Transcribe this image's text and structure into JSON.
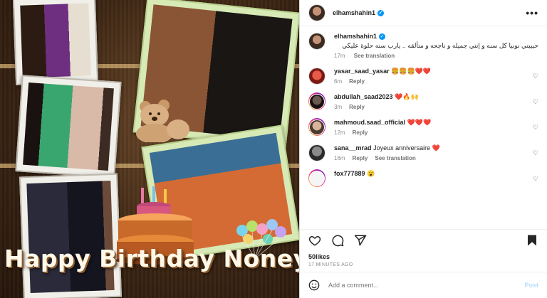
{
  "post_image": {
    "banner_text": "Happy Birthday Noneya"
  },
  "header": {
    "username": "elhamshahin1",
    "more_label": "•••"
  },
  "caption": {
    "username": "elhamshahin1",
    "text": "حبيبتي نونيا كل سنه و إنتي جميله و ناجحه و متألقه .. يارب سنه حلوة عليكي",
    "time": "17m",
    "see_translation": "See translation"
  },
  "comments": [
    {
      "username": "yasar_saad_yasar",
      "text": "🍔🍔🍔❤️❤️",
      "time": "6m",
      "reply": "Reply",
      "see_translation": ""
    },
    {
      "username": "abdullah_saad2023",
      "text": "❤️🔥🙌",
      "time": "3m",
      "reply": "Reply",
      "see_translation": ""
    },
    {
      "username": "mahmoud.saad_official",
      "text": "❤️❤️❤️",
      "time": "12m",
      "reply": "Reply",
      "see_translation": ""
    },
    {
      "username": "sana__mrad",
      "text": "Joyeux anniversaire ❤️",
      "time": "16m",
      "reply": "Reply",
      "see_translation": "See translation"
    },
    {
      "username": "fox777889",
      "text": "😮",
      "time": "",
      "reply": "",
      "see_translation": ""
    }
  ],
  "stats": {
    "likes": "50likes",
    "posted_ago": "17 MINUTES AGO"
  },
  "add_comment": {
    "placeholder": "Add a comment...",
    "post_label": "Post"
  },
  "icons": {
    "like": "heart-icon",
    "comment": "comment-icon",
    "share": "share-icon",
    "save": "bookmark-icon",
    "emoji": "smiley-icon"
  },
  "colors": {
    "verified_blue": "#0095f6",
    "post_disabled": "#b2dffc",
    "muted": "#8e8e8e"
  }
}
